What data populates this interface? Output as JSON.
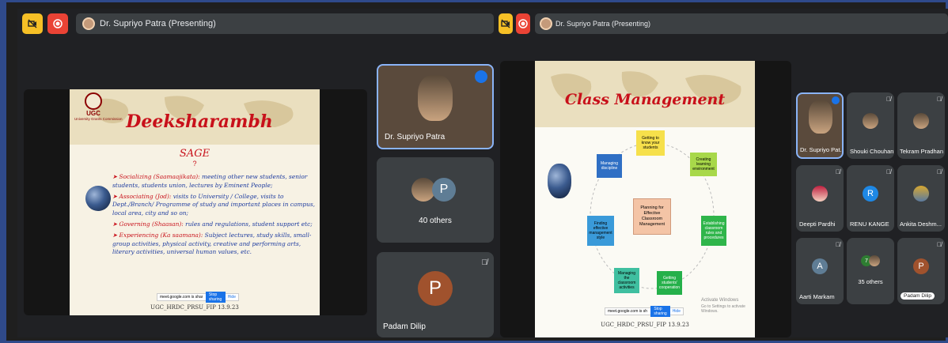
{
  "left_window": {
    "presenter_label": "Dr. Supriyo Patra (Presenting)",
    "slide": {
      "logo_caption": "UGC",
      "logo_subcaption": "University Grants Commission",
      "title": "Deeksharambh",
      "subtitle": "SAGE",
      "subtitle_mark": "?",
      "bullets": [
        {
          "head": "Socializing (Saamaajikata):",
          "body": " meeting other new students, senior students, students union, lectures by Eminent People;"
        },
        {
          "head": "Associating (Jod):",
          "body": " visits to University / College, visits to Dept./Branch/ Programme of study and important places in campus, local area, city and so on;"
        },
        {
          "head": "Governing (Shaasan):",
          "body": " rules and regulations, student support etc;"
        },
        {
          "head": "Experiencing (Ka saamana):",
          "body": " Subject lectures, study skills, small-group activities, physical activity, creative and performing arts, literary activities, universal human values, etc."
        }
      ],
      "footer": "UGC_HRDC_PRSU_FIP 13.9.23",
      "share_bar_text": "meet.google.com is sharing your screen.",
      "share_bar_button": "Stop sharing",
      "share_bar_hide": "Hide"
    },
    "tiles": [
      {
        "name": "Dr. Supriyo Patra"
      },
      {
        "name": "40 others",
        "avatar_letter": "P"
      },
      {
        "name": "Padam Dilip",
        "avatar_letter": "P"
      }
    ]
  },
  "right_window": {
    "presenter_label": "Dr. Supriyo Patra (Presenting)",
    "slide": {
      "title": "Class Management",
      "center": "Planning for Effective Classroom Management",
      "nodes": [
        {
          "label": "Getting to know your students",
          "color": "#f6e04b"
        },
        {
          "label": "Creating learning environment",
          "color": "#a8d84a"
        },
        {
          "label": "Establishing classroom rules and procedures",
          "color": "#2fb54a"
        },
        {
          "label": "Getting students' cooperation",
          "color": "#25b04a"
        },
        {
          "label": "Managing the classroom activities",
          "color": "#3fbfa0"
        },
        {
          "label": "Finding effective management style",
          "color": "#3a9ad9"
        },
        {
          "label": "Managing discipline",
          "color": "#2f6fc4"
        }
      ],
      "footer": "UGC_HRDC_PRSU_FIP 13.9.23",
      "share_bar_text": "meet.google.com is sharing your screen.",
      "share_bar_button": "Stop sharing",
      "share_bar_hide": "Hide",
      "activate_title": "Activate Windows",
      "activate_sub": "Go to Settings to activate Windows."
    },
    "tiles": [
      {
        "name": "Dr. Supriyo Pat..."
      },
      {
        "name": "Shouki Chouhan"
      },
      {
        "name": "Tekram Pradhan"
      },
      {
        "name": "Deepti Pardhi"
      },
      {
        "name": "RENU KANGE",
        "avatar_letter": "R"
      },
      {
        "name": "Ankita Deshm..."
      },
      {
        "name": "Aarti Markam",
        "avatar_letter": "A"
      },
      {
        "name": "35 others",
        "avatar_letter": "7"
      },
      {
        "name": "Padam Dilip",
        "avatar_letter": "P"
      }
    ]
  },
  "colors": {
    "frame": "#2f4a8a",
    "background": "#202124",
    "tile": "#3c4043",
    "yellow_button": "#f6c026",
    "red_button": "#ea4335",
    "slide_title_red": "#c8101a",
    "slide_blue_text": "#1d3b9f",
    "avatar_brown": "#a0522d",
    "avatar_blue": "#1e88e5",
    "avatar_blue_grey": "#5f7d95"
  }
}
